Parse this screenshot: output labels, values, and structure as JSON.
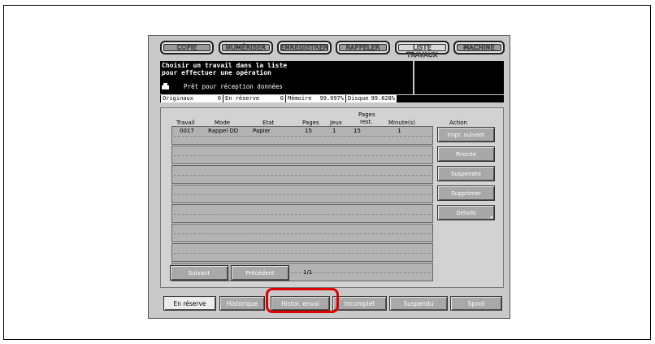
{
  "mode_buttons": [
    "COPIE",
    "NUMÉRISER",
    "ENREGISTRER",
    "RAPPELER",
    "LISTE TRAVAUX",
    "MACHINE"
  ],
  "message": {
    "line1": "Choisir un travail dans la liste",
    "line2": "pour effectuer une opération",
    "status": "Prêt pour réception données",
    "status_icon": "printer-icon"
  },
  "info_bar": {
    "originals_label": "Originaux",
    "originals_value": "0",
    "reserve_label": "En réserve",
    "reserve_value": "0",
    "memory_label": "Mémoire",
    "memory_value": "99.997%",
    "disk_label": "Disque",
    "disk_value": "99.828%"
  },
  "table": {
    "headers": {
      "job": "Travail",
      "mode": "Mode",
      "state": "Etat",
      "pages": "Pages",
      "sets": "Jeux",
      "pages_rest_1": "Pages",
      "pages_rest_2": "rest.",
      "minutes": "Minute(s)",
      "action": "Action"
    },
    "rows": [
      {
        "job": "0017",
        "mode": "Rappel DD",
        "state": "Papier",
        "pages": "15",
        "sets": "1",
        "pages_rest": "15",
        "minutes": "1"
      }
    ]
  },
  "actions": [
    "Impr. suivant",
    "Priorité",
    "Suspendre",
    "Supprimer",
    "Détails"
  ],
  "navigation": {
    "next": "Suivant",
    "previous": "Précédent",
    "page": "1/1"
  },
  "tabs": [
    "En réserve",
    "Historique",
    "Histor. envoi",
    "Incomplet",
    "Suspendu",
    "Spool"
  ],
  "highlight_color": "#e00000"
}
